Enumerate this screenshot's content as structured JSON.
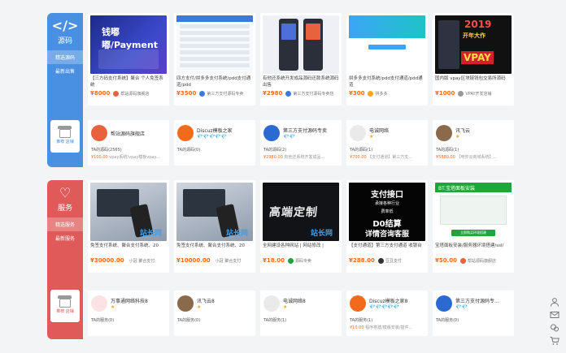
{
  "categories": [
    {
      "title": "源码",
      "icon": "</>",
      "tabs": [
        "精选源码",
        "最新出售"
      ],
      "shop_label": "推荐\n店铺"
    },
    {
      "title": "服务",
      "icon": "♡",
      "tabs": [
        "精选服务",
        "最新服务"
      ],
      "shop_label": "推荐\n店铺"
    }
  ],
  "source_products": [
    {
      "title": "【三方码支付系统】聚合 个人免签系统",
      "price": "¥8000",
      "seller": "帮站源码旗舰店",
      "thumb": {
        "t1": "钱嘟嘟/Payment",
        "t2": ""
      }
    },
    {
      "title": "四方支付/拼多多支付系统/pdd支付通道/pdd",
      "price": "¥3500",
      "seller": "第三方支付源码专卖"
    },
    {
      "title": "有他还系统开发成品源码还款系统源码出售",
      "price": "¥2980",
      "seller": "第三方支付源码专卖店"
    },
    {
      "title": "拼多多支付系统/pdd支付通道/pdd通道",
      "price": "¥300",
      "seller": "拼多多"
    },
    {
      "title": "国内版 vpay区块链钱包交易所源码",
      "price": "¥1000",
      "seller": "VPAY开发店铺",
      "thumb": {
        "y": "2019",
        "n": "开年大作",
        "v": "VPAY"
      }
    }
  ],
  "source_shops": [
    {
      "name": "帮站源码旗舰店",
      "rating": "",
      "line1": "TA的源码(2565)",
      "price": "¥100.00",
      "line2": "vpay系统/vpay模板vpay..."
    },
    {
      "name": "Discuz模板之家",
      "rating": "💎💎💎💎💎",
      "line1": "TA的源码(0)",
      "price": "",
      "line2": ""
    },
    {
      "name": "第三方支付源码专卖",
      "rating": "💎💎",
      "line1": "TA的源码(2)",
      "price": "¥2980.00",
      "line2": "有他还系统开发成品..."
    },
    {
      "name": "电诚网络",
      "rating": "★",
      "line1": "TA的源码(1)",
      "price": "¥700.00",
      "line2": "【支付通道】第三方支..."
    },
    {
      "name": "讯飞云",
      "rating": "★",
      "line1": "TA的源码(1)",
      "price": "¥5880.00",
      "line2": "【电你云商城系统】..."
    }
  ],
  "service_products": [
    {
      "title": "免签支付系统、聚合支付系统、20",
      "price": "¥30000.00",
      "seller": "小冠 聚合支付",
      "thumb": {
        "wm": "站长网"
      }
    },
    {
      "title": "免签支付系统、聚合支付系统、20",
      "price": "¥10000.00",
      "seller": "小冠 聚合支付",
      "thumb": {
        "wm": "站长网"
      }
    },
    {
      "title": "全网建设各种网站 | 网站修改 |",
      "price": "¥18.00",
      "seller": "源码专卖",
      "thumb": {
        "big": "高端定制",
        "wm": "站长网"
      }
    },
    {
      "title": "【支付通道】第三方支付通道 收银台",
      "price": "¥288.00",
      "seller": "豆豆支付",
      "thumb": {
        "a": "支付接口",
        "b": "承接各种行业",
        "c": "费率低",
        "d": "D0结算",
        "e": "详情咨询客服"
      }
    },
    {
      "title": "宝塔面板安装/服务器环境搭建/ssl/",
      "price": "¥50.00",
      "seller": "帮站源码旗舰店",
      "thumb": {
        "hd": "BT.宝塔面板安装",
        "btn": "立即购买环境搭建"
      }
    }
  ],
  "service_shops": [
    {
      "name": "万事通网络科技8",
      "rating": "★",
      "line1": "TA的服务(0)",
      "price": "",
      "line2": ""
    },
    {
      "name": "讯飞云8",
      "rating": "★",
      "line1": "TA的服务(0)",
      "price": "",
      "line2": ""
    },
    {
      "name": "电诚网络8",
      "rating": "★",
      "line1": "TA的服务(1)",
      "price": "",
      "line2": ""
    },
    {
      "name": "Discuz模板之家8",
      "rating": "💎💎💎💎💎",
      "line1": "TA的服务(1)",
      "price": "¥10.00",
      "line2": "程序搭建/模版安装/插件..."
    },
    {
      "name": "第三方支付源码专...",
      "rating": "💎💎",
      "line1": "TA的服务(0)",
      "price": "",
      "line2": ""
    }
  ],
  "right_bar": [
    "user-icon",
    "mail-icon",
    "chat-icon",
    "cart-icon"
  ],
  "colors": {
    "source": "#4a90e2",
    "service": "#e05a5a",
    "price": "#f26b1d"
  }
}
